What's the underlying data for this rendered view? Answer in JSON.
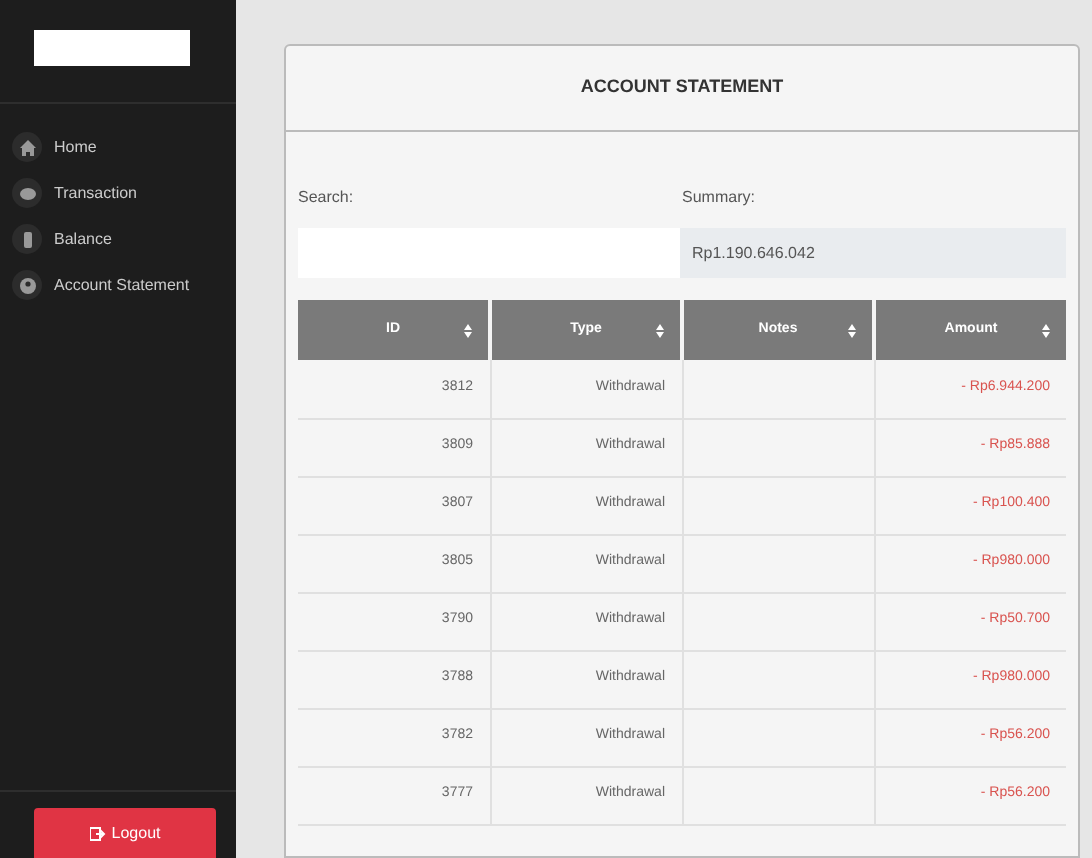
{
  "sidebar": {
    "items": [
      {
        "label": "Home"
      },
      {
        "label": "Transaction"
      },
      {
        "label": "Balance"
      },
      {
        "label": "Account Statement"
      }
    ],
    "logout": "Logout"
  },
  "card": {
    "title": "ACCOUNT STATEMENT",
    "search": {
      "label": "Search:"
    },
    "summary": {
      "label": "Summary:",
      "value": "Rp1.190.646.042"
    },
    "table": {
      "columns": [
        "ID",
        "Type",
        "Notes",
        "Amount"
      ],
      "rows": [
        {
          "id": "3812",
          "type": "Withdrawal",
          "amount": "- Rp6.944.200"
        },
        {
          "id": "3809",
          "type": "Withdrawal",
          "amount": "- Rp85.888"
        },
        {
          "id": "3807",
          "type": "Withdrawal",
          "amount": "- Rp100.400"
        },
        {
          "id": "3805",
          "type": "Withdrawal",
          "amount": "- Rp980.000"
        },
        {
          "id": "3790",
          "type": "Withdrawal",
          "amount": "- Rp50.700"
        },
        {
          "id": "3788",
          "type": "Withdrawal",
          "amount": "- Rp980.000"
        },
        {
          "id": "3782",
          "type": "Withdrawal",
          "amount": "- Rp56.200"
        },
        {
          "id": "3777",
          "type": "Withdrawal",
          "amount": "- Rp56.200"
        }
      ]
    }
  }
}
